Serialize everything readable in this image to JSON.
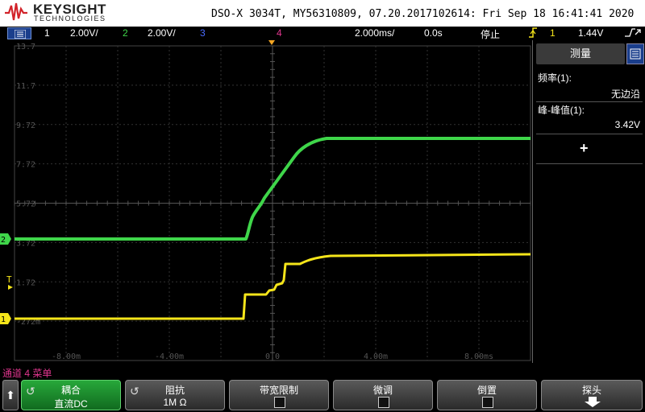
{
  "header": {
    "brand": "KEYSIGHT",
    "brand_sub": "TECHNOLOGIES",
    "title": "DSO-X 3034T, MY56310809, 07.20.2017102614: Fri Sep 18 16:41:41 2020"
  },
  "status": {
    "ch1_num": "1",
    "ch1_scale": "2.00V/",
    "ch2_num": "2",
    "ch2_scale": "2.00V/",
    "ch3_num": "3",
    "ch4_num": "4",
    "timebase": "2.000ms/",
    "delay": "0.0s",
    "run_state": "停止",
    "trig_channel": "1",
    "trig_level": "1.44V",
    "colors": {
      "ch1": "#f5e51a",
      "ch2": "#3fd64a",
      "ch3": "#4a6cff",
      "ch4": "#e0368e",
      "trigger": "#f5e51a"
    }
  },
  "graticule": {
    "y_labels": [
      "13.7",
      "11.7",
      "9.72",
      "7.72",
      "5.72",
      "3.72",
      "1.72",
      "-272m"
    ],
    "x_labels": [
      "-8.00m",
      "-4.00m",
      "0.0",
      "4.00m",
      "8.00ms"
    ],
    "trigger_marker": "T",
    "ch1_marker": "1",
    "ch2_marker": "2"
  },
  "traces": {
    "ch2_color": "#3fd64a",
    "ch1_color": "#f5e51a"
  },
  "panel": {
    "title": "测量",
    "m1_label": "频率(1):",
    "m1_value": "无边沿",
    "m2_label": "峰-峰值(1):",
    "m2_value": "3.42V",
    "add": "+"
  },
  "menu": {
    "title": "通道 4 菜单",
    "back": "⬆",
    "coupling_label": "耦合",
    "coupling_value": "直流DC",
    "impedance_label": "阻抗",
    "impedance_value": "1M Ω",
    "bw_label": "带宽限制",
    "fine_label": "微调",
    "invert_label": "倒置",
    "probe_label": "探头"
  }
}
